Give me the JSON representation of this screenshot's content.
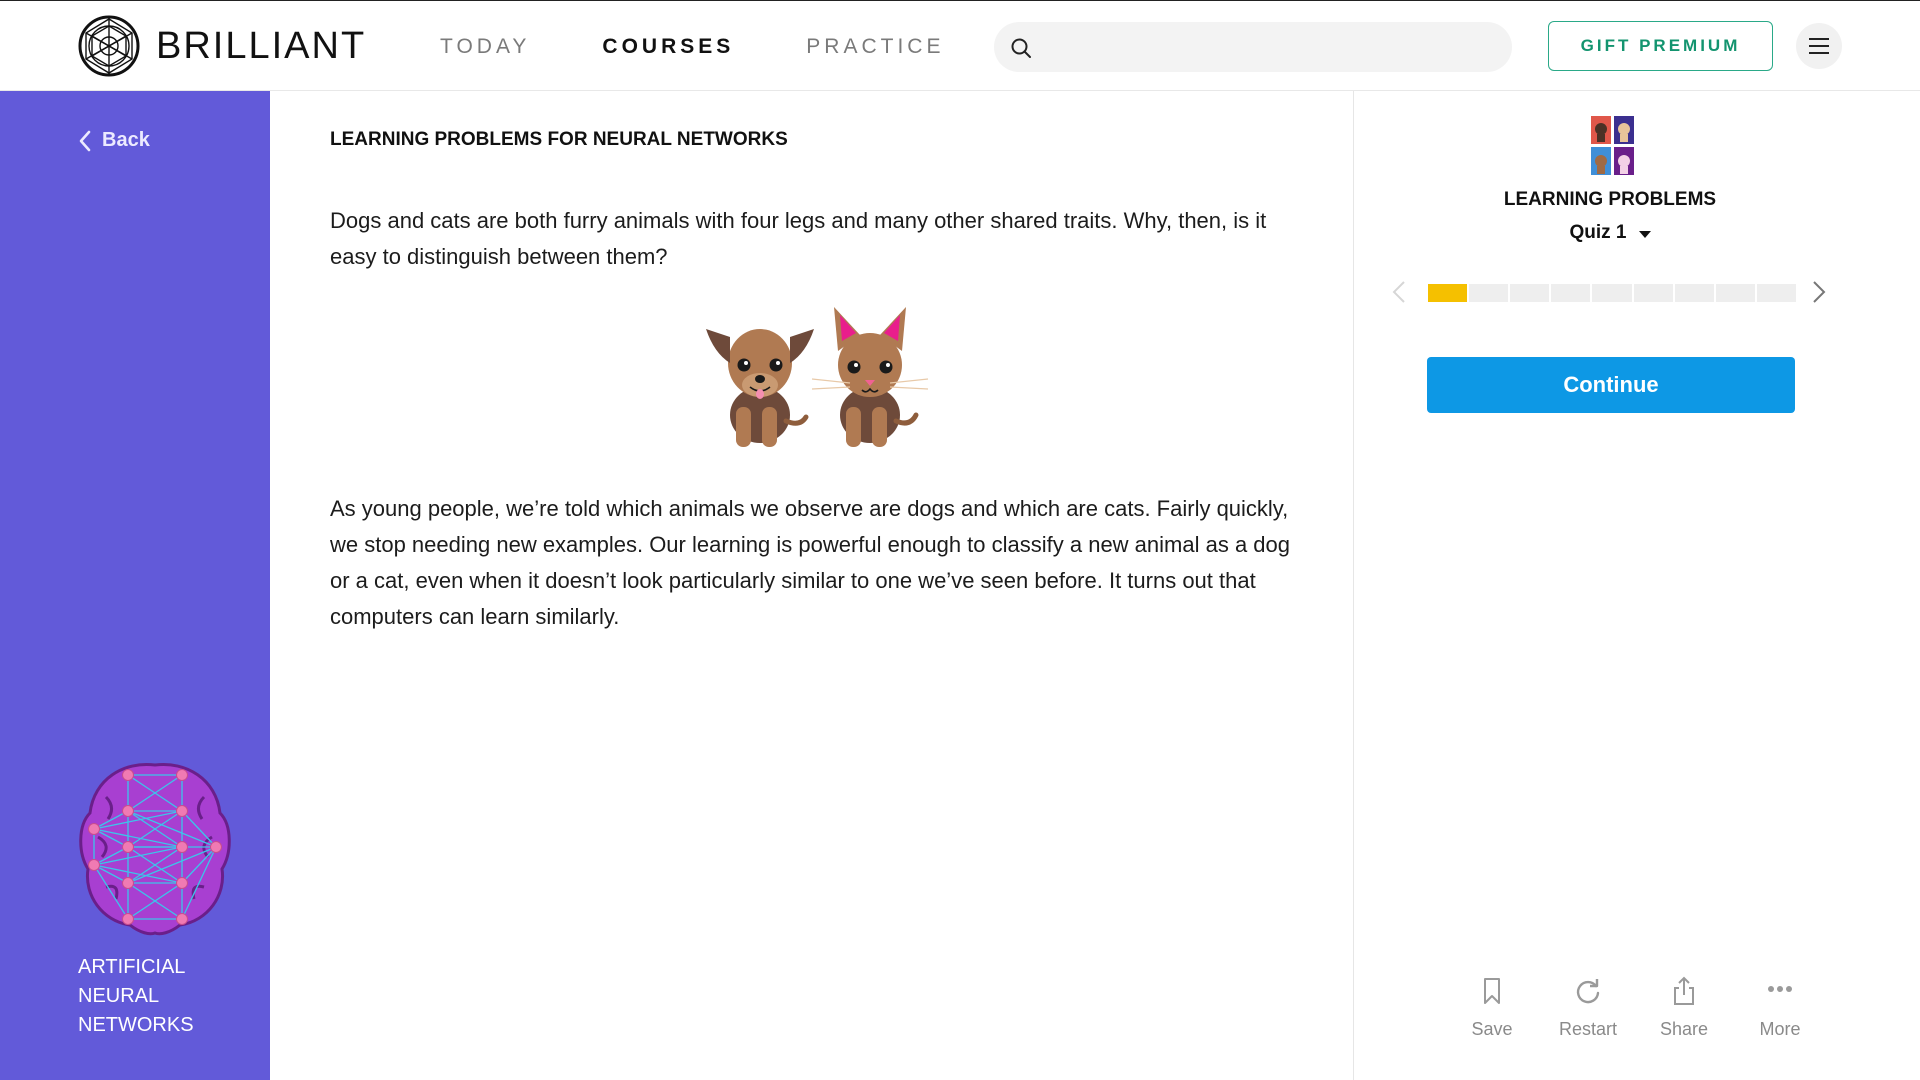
{
  "header": {
    "logo_text": "BRILLIANT",
    "nav": [
      {
        "label": "TODAY",
        "active": false
      },
      {
        "label": "COURSES",
        "active": true
      },
      {
        "label": "PRACTICE",
        "active": false
      }
    ],
    "search": {
      "placeholder": ""
    },
    "gift_button": "GIFT PREMIUM",
    "icons": {
      "search": "search-icon",
      "menu": "hamburger-menu-icon",
      "logo": "brilliant-logo-icon"
    }
  },
  "sidebar": {
    "back_label": "Back",
    "course_name": "ARTIFICIAL NEURAL NETWORKS",
    "bg_color": "#625ad9"
  },
  "main": {
    "section_title": "LEARNING PROBLEMS FOR NEURAL NETWORKS",
    "paragraph_1": "Dogs and cats are both furry animals with four legs and many other shared traits. Why, then, is it easy to distinguish between them?",
    "paragraph_2": "As young people, we’re told which animals we observe are dogs and which are cats. Fairly quickly, we stop needing new examples. Our learning is powerful enough to classify a new animal as a dog or a cat, even when it doesn’t look particularly similar to one we’ve seen before. It turns out that computers can learn similarly.",
    "illustration": "dog-and-cat-illustration"
  },
  "panel": {
    "lesson_title": "LEARNING PROBLEMS",
    "quiz_label": "Quiz 1",
    "progress": {
      "total_segments": 9,
      "completed_segments": 1,
      "accent_color": "#f5c000"
    },
    "continue_label": "Continue",
    "continue_color": "#0d98e5",
    "actions": [
      {
        "label": "Save",
        "icon": "bookmark-icon"
      },
      {
        "label": "Restart",
        "icon": "restart-icon"
      },
      {
        "label": "Share",
        "icon": "share-icon"
      },
      {
        "label": "More",
        "icon": "more-dots-icon"
      }
    ]
  }
}
